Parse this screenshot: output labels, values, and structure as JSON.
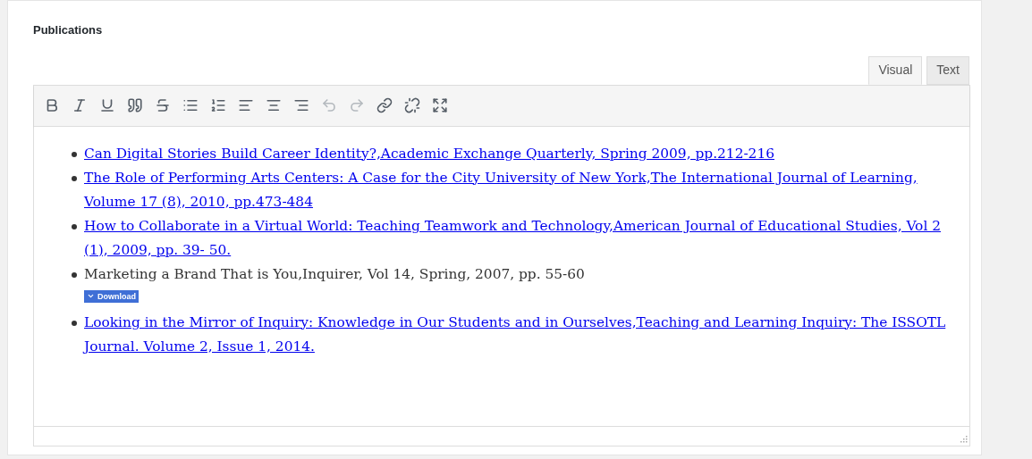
{
  "section": {
    "title": "Publications"
  },
  "tabs": [
    {
      "label": "Visual",
      "selected": true
    },
    {
      "label": "Text",
      "selected": false
    }
  ],
  "toolbar": [
    {
      "kind": "bold",
      "disabled": false
    },
    {
      "kind": "italic",
      "disabled": false
    },
    {
      "kind": "underline",
      "disabled": false
    },
    {
      "kind": "quote",
      "disabled": false
    },
    {
      "kind": "strikethrough",
      "disabled": false
    },
    {
      "kind": "bullets",
      "disabled": false
    },
    {
      "kind": "numbers",
      "disabled": false
    },
    {
      "kind": "align-left",
      "disabled": false
    },
    {
      "kind": "align-center",
      "disabled": false
    },
    {
      "kind": "align-right",
      "disabled": false
    },
    {
      "kind": "undo",
      "disabled": true
    },
    {
      "kind": "redo",
      "disabled": true
    },
    {
      "kind": "link",
      "disabled": false
    },
    {
      "kind": "unlink",
      "disabled": false
    },
    {
      "kind": "fullscreen",
      "disabled": false
    }
  ],
  "publications": [
    {
      "kind": "link",
      "text": "Can Digital Stories Build Career Identity?,Academic Exchange Quarterly, Spring 2009, pp.212-216"
    },
    {
      "kind": "link",
      "text": "The Role of Performing Arts Centers: A Case for the City University of New York,The International Journal of Learning, Volume 17 (8), 2010, pp.473-484"
    },
    {
      "kind": "link",
      "text": "How to Collaborate in a Virtual World: Teaching Teamwork and Technology,American Journal of Educational Studies, Vol 2 (1), 2009, pp. 39- 50."
    },
    {
      "kind": "text",
      "text": "Marketing a Brand That is You,Inquirer, Vol 14, Spring, 2007, pp. 55-60",
      "download": "Download"
    },
    {
      "kind": "link",
      "text": "Looking in the Mirror of Inquiry: Knowledge in Our Students and in Ourselves,Teaching and Learning Inquiry: The ISSOTL Journal. Volume 2, Issue 1, 2014."
    }
  ]
}
